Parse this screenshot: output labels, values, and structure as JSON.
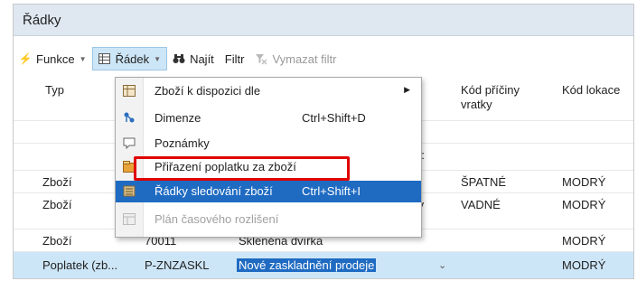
{
  "window": {
    "title": "Řádky"
  },
  "toolbar": {
    "funkce": "Funkce",
    "radek": "Řádek",
    "najit": "Najít",
    "filtr": "Filtr",
    "vymazat_filtr": "Vymazat filtr"
  },
  "columns": {
    "typ": "Typ",
    "kod_priciny_vratky": "Kód příčiny vratky",
    "kod_lokace": "Kód lokace"
  },
  "rows": [
    {
      "partial": "5:"
    },
    {
      "typ": "Zboží",
      "kod_priciny": "ŠPATNÉ",
      "kod_lokace": "MODRÝ"
    },
    {
      "typ": "Zboží",
      "partial": "ty",
      "kod_priciny": "VADNÉ",
      "kod_lokace": "MODRÝ"
    },
    {
      "typ": "Zboží",
      "cislo": "70011",
      "popis": "Skleněná dvířka",
      "kod_lokace": "MODRÝ"
    },
    {
      "typ": "Poplatek (zb...",
      "cislo": "P-ZNZASKL",
      "popis": "Nové zaskladnění prodeje",
      "kod_lokace": "MODRÝ"
    }
  ],
  "menu": {
    "items": [
      {
        "label": "Zboží k dispozici dle",
        "shortcut": "",
        "submenu_arrow": "▶"
      },
      {
        "label": "Dimenze",
        "shortcut": "Ctrl+Shift+D"
      },
      {
        "label": "Poznámky",
        "shortcut": ""
      },
      {
        "label": "Přiřazení poplatku za zboží",
        "shortcut": ""
      },
      {
        "label": "Řádky sledování zboží",
        "shortcut": "Ctrl+Shift+I"
      },
      {
        "label": "Plán časového rozlišení",
        "shortcut": ""
      }
    ]
  },
  "colors": {
    "accent": "#1f6bc2",
    "selected_row": "#cde6f7",
    "annotation_box": "#e00000",
    "title_bar": "#dfe7f0"
  },
  "icons": [
    "lightning-icon",
    "table-icon",
    "binoculars-icon",
    "clear-filter-icon",
    "stock-grid-icon",
    "dimensions-icon",
    "note-icon",
    "charge-assignment-icon",
    "item-tracking-icon",
    "deferral-icon",
    "submenu-arrow-icon",
    "chevron-down-icon"
  ]
}
